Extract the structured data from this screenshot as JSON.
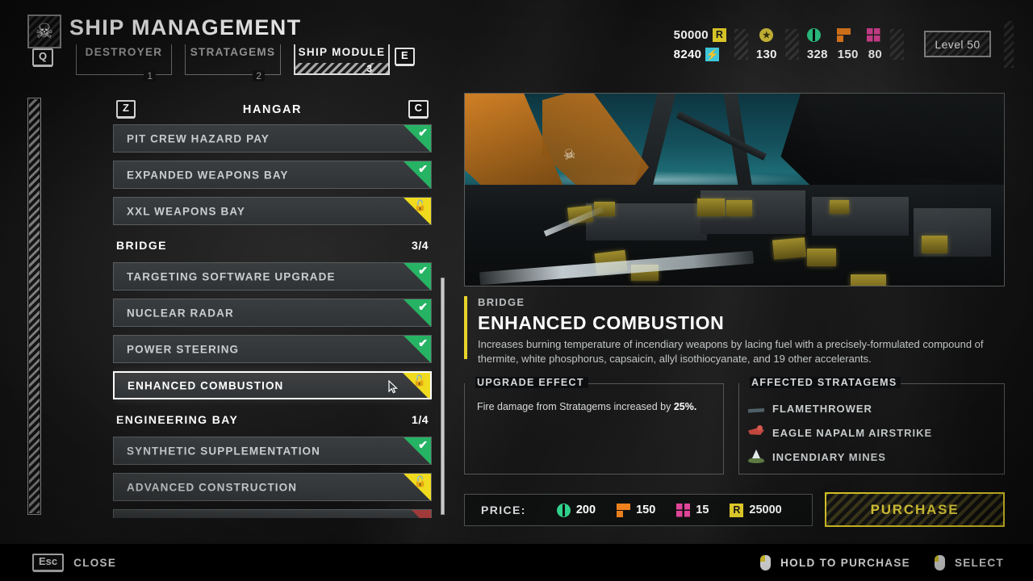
{
  "header": {
    "title": "SHIP MANAGEMENT",
    "skull_icon": "skull-icon",
    "prev_key": "Q",
    "next_key": "E",
    "tabs": [
      {
        "label": "DESTROYER",
        "number": "1",
        "active": false
      },
      {
        "label": "STRATAGEMS",
        "number": "2",
        "active": false
      },
      {
        "label": "SHIP MODULE",
        "number": "3",
        "active": true
      }
    ]
  },
  "resources": {
    "requisition": {
      "value": "50000",
      "icon": "requisition-icon",
      "glyph": "R",
      "color": "#e8d32a"
    },
    "medals": {
      "value": "8240",
      "icon": "medal-icon",
      "glyph": "⚡",
      "color": "#3fcde0"
    },
    "super_credits": {
      "value": "130",
      "icon": "super-credit-icon",
      "color": "#d4c13a"
    },
    "common_samples": {
      "value": "328",
      "icon": "common-sample-icon",
      "color": "#2fd18b"
    },
    "rare_samples": {
      "value": "150",
      "icon": "rare-sample-icon",
      "color": "#f0821e"
    },
    "super_samples": {
      "value": "80",
      "icon": "super-sample-icon",
      "color": "#e8479f"
    },
    "level": "Level 50"
  },
  "list": {
    "prev_key": "Z",
    "next_key": "C",
    "title": "HANGAR",
    "entries": [
      {
        "kind": "row",
        "label": "PIT CREW HAZARD PAY",
        "state": "owned"
      },
      {
        "kind": "row",
        "label": "EXPANDED WEAPONS BAY",
        "state": "owned"
      },
      {
        "kind": "row",
        "label": "XXL WEAPONS BAY",
        "state": "locked"
      },
      {
        "kind": "group",
        "label": "BRIDGE",
        "count": "3/4"
      },
      {
        "kind": "row",
        "label": "TARGETING SOFTWARE UPGRADE",
        "state": "owned"
      },
      {
        "kind": "row",
        "label": "NUCLEAR RADAR",
        "state": "owned"
      },
      {
        "kind": "row",
        "label": "POWER STEERING",
        "state": "owned"
      },
      {
        "kind": "row",
        "label": "ENHANCED COMBUSTION",
        "state": "locked",
        "selected": true
      },
      {
        "kind": "group",
        "label": "ENGINEERING BAY",
        "count": "1/4"
      },
      {
        "kind": "row",
        "label": "SYNTHETIC SUPPLEMENTATION",
        "state": "owned"
      },
      {
        "kind": "row",
        "label": "ADVANCED CONSTRUCTION",
        "state": "locked"
      },
      {
        "kind": "partial"
      }
    ]
  },
  "detail": {
    "category": "BRIDGE",
    "name": "ENHANCED COMBUSTION",
    "description": "Increases burning temperature of incendiary weapons by lacing fuel with a precisely-formulated compound of thermite, white phosphorus, capsaicin, allyl isothiocyanate, and 19 other accelerants.",
    "effect": {
      "heading": "UPGRADE EFFECT",
      "text_before": "Fire damage from Stratagems increased by ",
      "value": "25%."
    },
    "stratagems": {
      "heading": "AFFECTED STRATAGEMS",
      "items": [
        {
          "label": "FLAMETHROWER",
          "icon": "flamethrower-icon"
        },
        {
          "label": "EAGLE NAPALM AIRSTRIKE",
          "icon": "eagle-napalm-airstrike-icon"
        },
        {
          "label": "INCENDIARY MINES",
          "icon": "incendiary-mines-icon"
        }
      ]
    },
    "price": {
      "label": "PRICE:",
      "items": [
        {
          "value": "200",
          "icon": "common-sample-icon"
        },
        {
          "value": "150",
          "icon": "rare-sample-icon"
        },
        {
          "value": "15",
          "icon": "super-sample-icon"
        },
        {
          "value": "25000",
          "icon": "requisition-icon"
        }
      ]
    },
    "purchase_label": "PURCHASE"
  },
  "footer": {
    "close_key": "Esc",
    "close_label": "CLOSE",
    "hold_label": "HOLD TO PURCHASE",
    "select_label": "SELECT"
  }
}
